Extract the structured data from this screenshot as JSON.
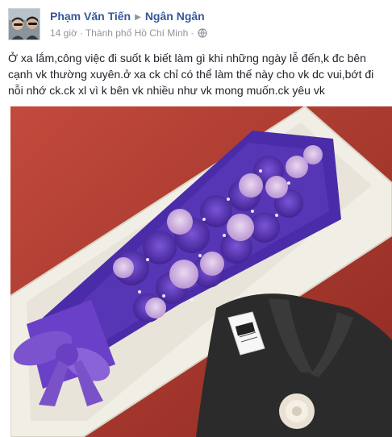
{
  "post": {
    "author_name": "Phạm Văn Tiến",
    "arrow_icon": "triangle-right-icon",
    "recipient_name": "Ngân Ngân",
    "time": "14 giờ",
    "separator": "·",
    "location": "Thành phố Hồ Chí Minh",
    "separator2": "·",
    "privacy_icon": "globe-icon",
    "text": "Ở xa lắm,công việc đi suốt k biết làm gì khi những ngày lễ đến,k đc bên cạnh vk thường xuyên.ở xa ck chỉ có thể làm thế này cho vk dc vui,bớt đi nỗi nhớ ck.ck xl vì k bên vk nhiều như vk mong muốn.ck yêu vk"
  },
  "colors": {
    "link_blue": "#365899",
    "meta_gray": "#90949c",
    "text": "#1d2129",
    "table_red": "#b23a2f",
    "box_white": "#f3f1ea",
    "tissue_purple": "#5a3ab0",
    "rose_pink": "#c9a5d8",
    "ribbon_purple": "#7a52c8",
    "jacket_black": "#2b2b2b"
  }
}
